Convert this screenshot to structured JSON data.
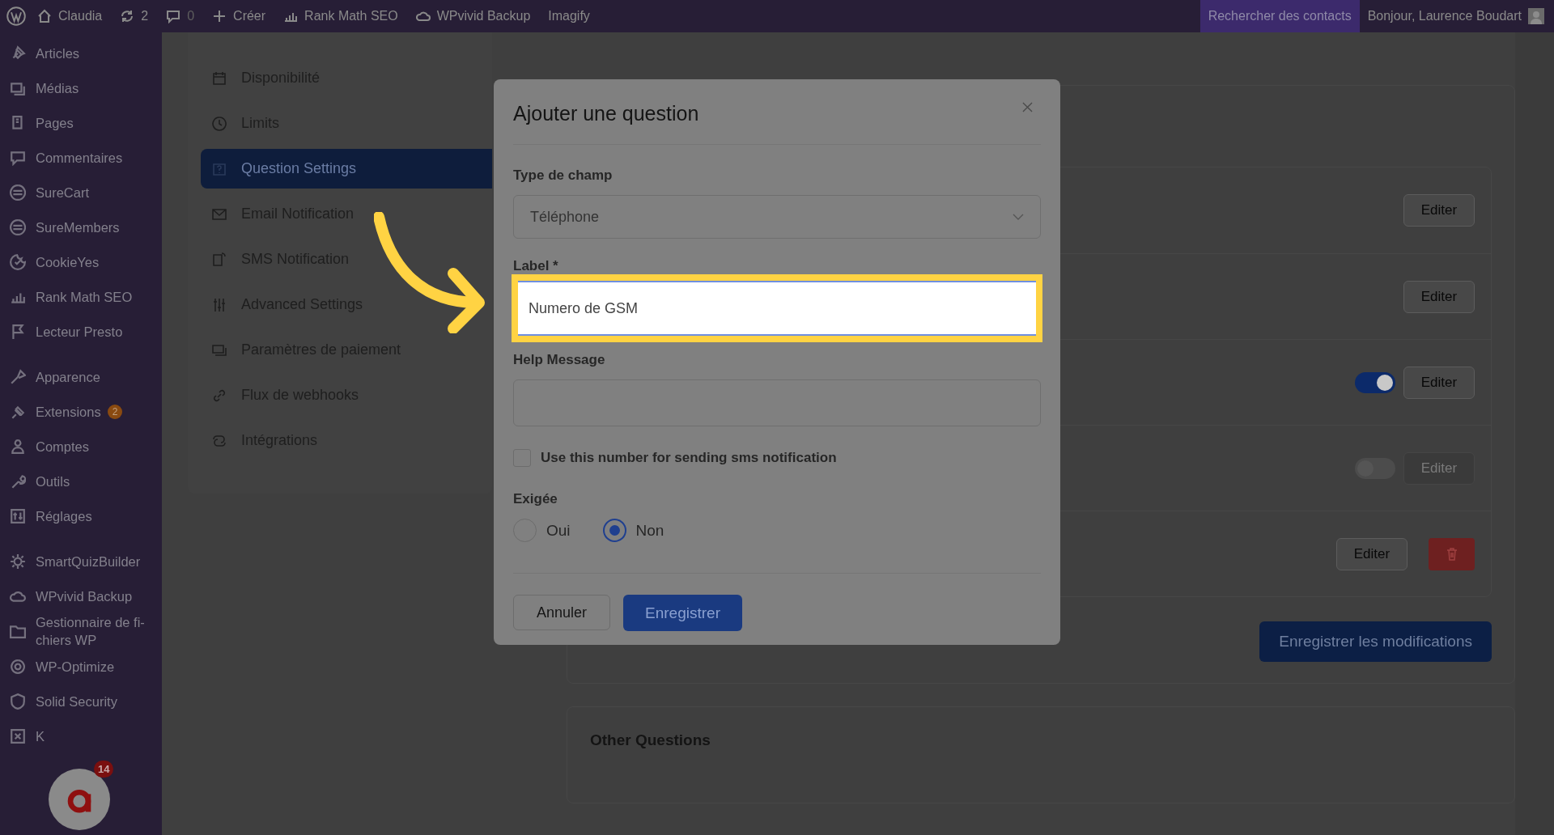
{
  "admin_bar": {
    "items": [
      {
        "label": "Claudia"
      },
      {
        "label": "2"
      },
      {
        "label": "0"
      },
      {
        "label": "Créer"
      },
      {
        "label": "Rank Math SEO"
      },
      {
        "label": "WPvivid Backup"
      },
      {
        "label": "Imagify"
      }
    ],
    "search_contacts": "Rechercher des contacts",
    "greeting": "Bonjour, Laurence Boudart"
  },
  "sidebar": {
    "groups": [
      {
        "items": [
          {
            "label": "Articles"
          },
          {
            "label": "Médias"
          },
          {
            "label": "Pages"
          },
          {
            "label": "Commentaires"
          },
          {
            "label": "SureCart"
          },
          {
            "label": "SureMembers"
          },
          {
            "label": "CookieYes"
          },
          {
            "label": "Rank Math SEO"
          },
          {
            "label": "Lecteur Presto"
          }
        ]
      },
      {
        "items": [
          {
            "label": "Apparence"
          },
          {
            "label": "Extensions",
            "badge": "2"
          },
          {
            "label": "Comptes"
          },
          {
            "label": "Outils"
          },
          {
            "label": "Réglages"
          }
        ]
      },
      {
        "items": [
          {
            "label": "SmartQuizBuilder"
          },
          {
            "label": "WPvivid Backup"
          },
          {
            "label": "Gestionnaire de fi-chiers WP"
          },
          {
            "label": "WP-Optimize"
          },
          {
            "label": "Solid Security"
          },
          {
            "label": "K"
          }
        ]
      }
    ],
    "floating_widget": {
      "badge": "14"
    }
  },
  "settings_nav": {
    "items": [
      {
        "label": "Disponibilité",
        "selected": false
      },
      {
        "label": "Limits",
        "selected": false
      },
      {
        "label": "Question Settings",
        "selected": true
      },
      {
        "label": "Email Notification",
        "selected": false
      },
      {
        "label": "SMS Notification",
        "selected": false
      },
      {
        "label": "Advanced Settings",
        "selected": false
      },
      {
        "label": "Paramètres de paiement",
        "selected": false
      },
      {
        "label": "Flux de webhooks",
        "selected": false
      },
      {
        "label": "Intégrations",
        "selected": false
      }
    ]
  },
  "questions": {
    "rows": [
      {
        "edit": "Editer",
        "disabled": false,
        "deletable": false
      },
      {
        "edit": "Editer",
        "disabled": false,
        "deletable": false
      },
      {
        "edit": "Editer",
        "disabled": false,
        "deletable": false,
        "toggle_on": true
      },
      {
        "edit": "Editer",
        "disabled": true,
        "deletable": false,
        "toggle_on": false
      },
      {
        "edit": "Editer",
        "disabled": false,
        "deletable": true
      }
    ],
    "save_button": "Enregistrer les modifications"
  },
  "other_questions": {
    "title": "Other Questions"
  },
  "modal": {
    "title": "Ajouter une question",
    "field_type": {
      "label": "Type de champ",
      "value": "Téléphone"
    },
    "label_field": {
      "label": "Label *",
      "value": "Numero de GSM",
      "highlighted": true
    },
    "help_field": {
      "label": "Help Message"
    },
    "sms_checkbox": {
      "label": "Use this number for sending sms notification",
      "checked": false
    },
    "required": {
      "label": "Exigée",
      "options": [
        {
          "label": "Oui",
          "selected": false
        },
        {
          "label": "Non",
          "selected": true
        }
      ]
    },
    "cancel_button": "Annuler",
    "save_button": "Enregistrer"
  }
}
